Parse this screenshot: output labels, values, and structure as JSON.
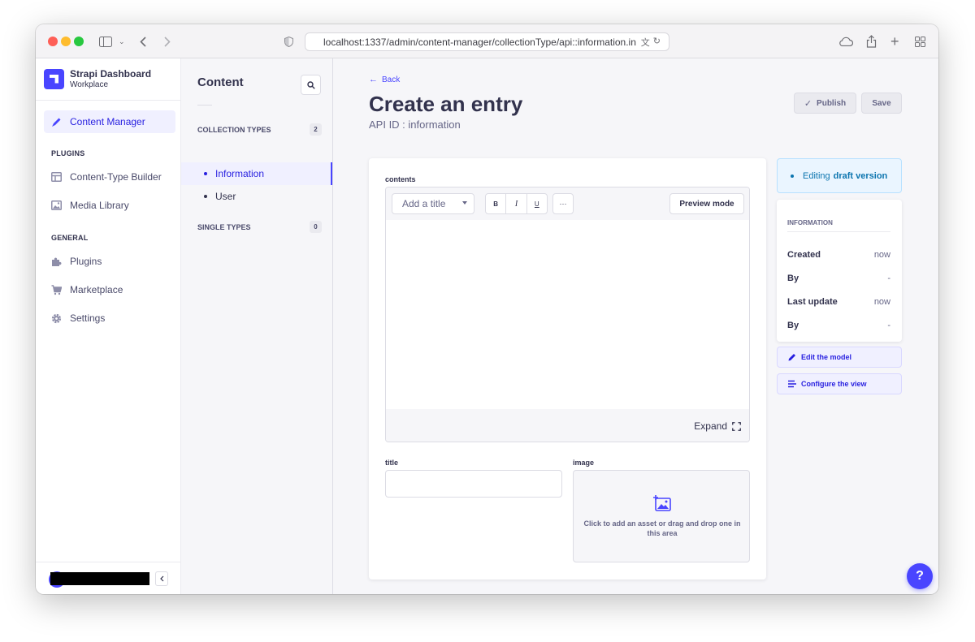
{
  "browser": {
    "url": "localhost:1337/admin/content-manager/collectionType/api::information.information"
  },
  "brand": {
    "title": "Strapi Dashboard",
    "subtitle": "Workplace"
  },
  "leftnav": {
    "content_manager": "Content Manager",
    "plugins_section": "PLUGINS",
    "content_type_builder": "Content-Type Builder",
    "media_library": "Media Library",
    "general_section": "GENERAL",
    "plugins": "Plugins",
    "marketplace": "Marketplace",
    "settings": "Settings"
  },
  "subnav": {
    "title": "Content",
    "collection_types": "COLLECTION TYPES",
    "collection_count": "2",
    "items": [
      {
        "label": "Information",
        "active": true
      },
      {
        "label": "User",
        "active": false
      }
    ],
    "single_types": "SINGLE TYPES",
    "single_count": "0"
  },
  "main": {
    "back": "Back",
    "title": "Create an entry",
    "api_id": "API ID : information",
    "publish": "Publish",
    "save": "Save"
  },
  "form": {
    "contents_label": "contents",
    "add_title": "Add a title",
    "bold": "B",
    "italic": "I",
    "underline": "U",
    "more": "···",
    "preview_mode": "Preview mode",
    "expand": "Expand",
    "title_label": "title",
    "title_value": "",
    "image_label": "image",
    "image_drop_text": "Click to add an asset or drag and drop one in this area"
  },
  "sidebar": {
    "editing_prefix": "Editing",
    "editing_bold": "draft version",
    "info_heading": "INFORMATION",
    "rows": [
      {
        "key": "Created",
        "value": "now"
      },
      {
        "key": "By",
        "value": "-"
      },
      {
        "key": "Last update",
        "value": "now"
      },
      {
        "key": "By",
        "value": "-"
      }
    ],
    "edit_model": "Edit the model",
    "configure_view": "Configure the view"
  },
  "help": "?",
  "colors": {
    "primary": "#4945ff",
    "primary_text": "#271fe0",
    "heading": "#32324d",
    "muted": "#666687",
    "draft_bg": "#eaf5ff",
    "draft_text": "#0c75af"
  },
  "icons": {
    "content_manager": "feather-pen-icon",
    "content_type_builder": "layout-icon",
    "media_library": "image-icon",
    "plugins": "puzzle-icon",
    "marketplace": "cart-icon",
    "settings": "gear-icon",
    "search": "search-icon",
    "back": "arrow-left-icon",
    "publish": "check-icon",
    "expand": "expand-icon",
    "image_upload": "add-image-icon",
    "edit_model": "pencil-icon",
    "configure_view": "list-icon"
  }
}
